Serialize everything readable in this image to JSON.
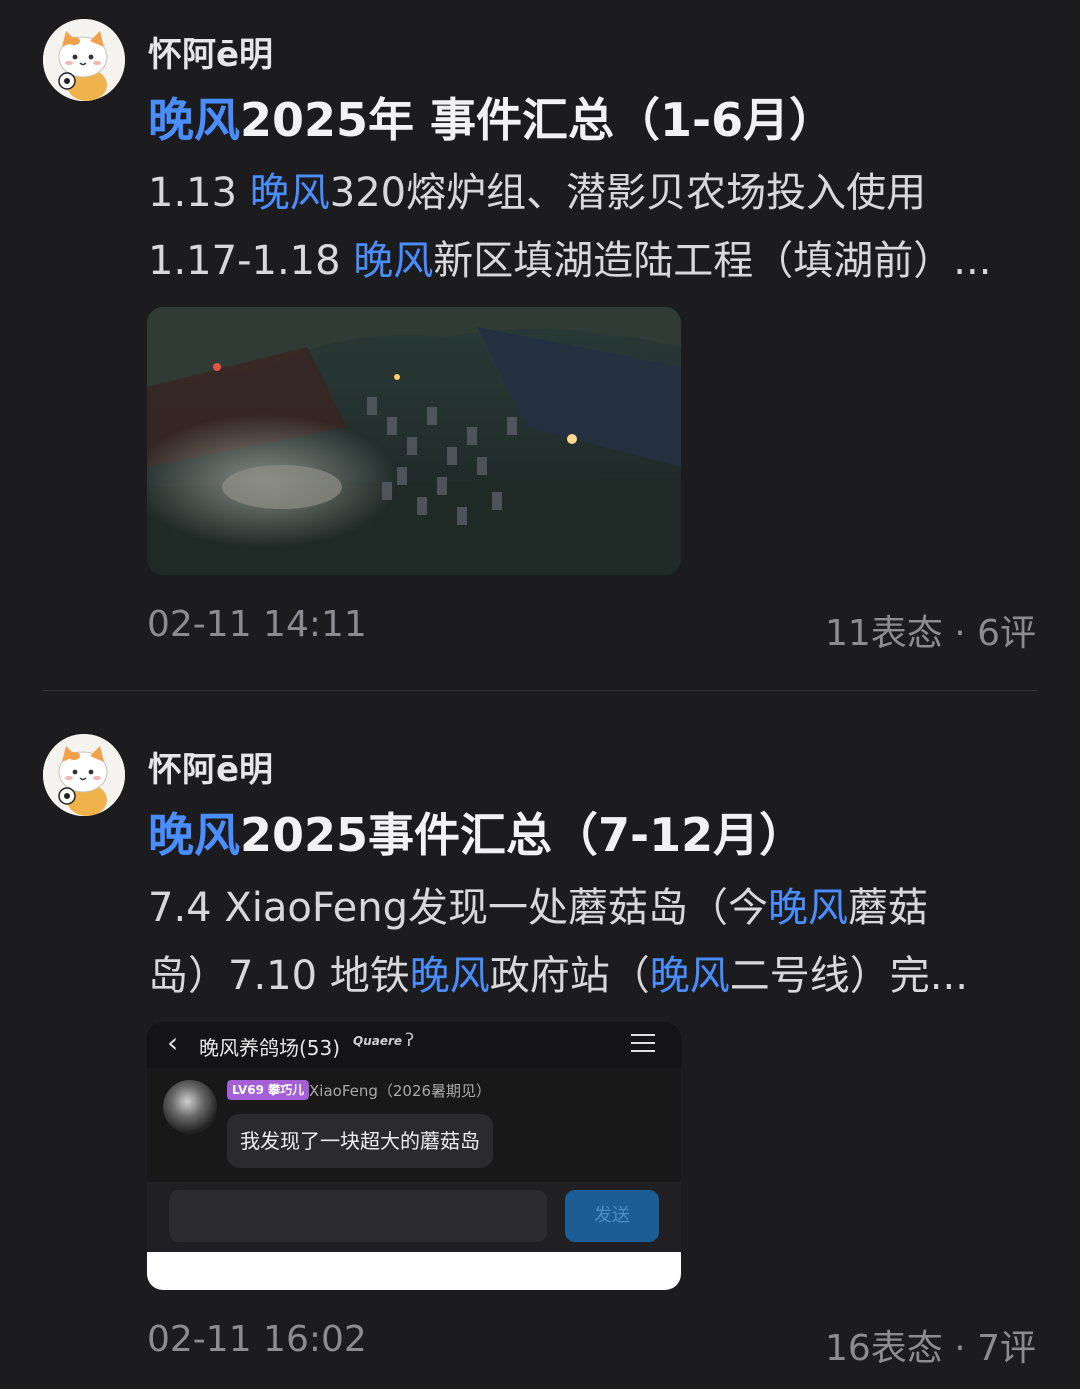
{
  "posts": [
    {
      "author": "怀阿ē明",
      "title": {
        "hl": "晚风",
        "rest": "2025年 事件汇总（1-6月）"
      },
      "line1": {
        "pre": "1.13  ",
        "hl": "晚风",
        "rest": "320熔炉组、潜影贝农场投入使用"
      },
      "line2": {
        "pre": "1.17-1.18  ",
        "hl": "晚风",
        "rest": "新区填湖造陆工程（填湖前）..."
      },
      "time": "02-11 14:11",
      "stats": "11表态 · 6评"
    },
    {
      "author": "怀阿ē明",
      "title": {
        "hl": "晚风",
        "rest": "2025事件汇总（7-12月）"
      },
      "line1": {
        "pre": "7.4  XiaoFeng发现一处蘑菇岛（今",
        "hl": "晚风",
        "rest": "蘑菇"
      },
      "line2": {
        "pre": "岛）7.10  地铁",
        "hl": "晚风",
        "mid": "政府站（",
        "hl2": "晚风",
        "rest": "二号线）完..."
      },
      "time": "02-11 16:02",
      "stats": "16表态 · 7评"
    }
  ],
  "chat": {
    "back_icon": "chevron-left-icon",
    "title": "晚风养鸽场(53)",
    "badge_text": "Quaere",
    "level": "LV69 攀巧儿",
    "sender": "XiaoFeng（2026暑期见）",
    "message": "我发现了一块超大的蘑菇岛",
    "send_label": "发送"
  },
  "colors": {
    "background": "#1c1c1e",
    "highlight": "#4a8dff",
    "meta": "#8c8c90"
  }
}
